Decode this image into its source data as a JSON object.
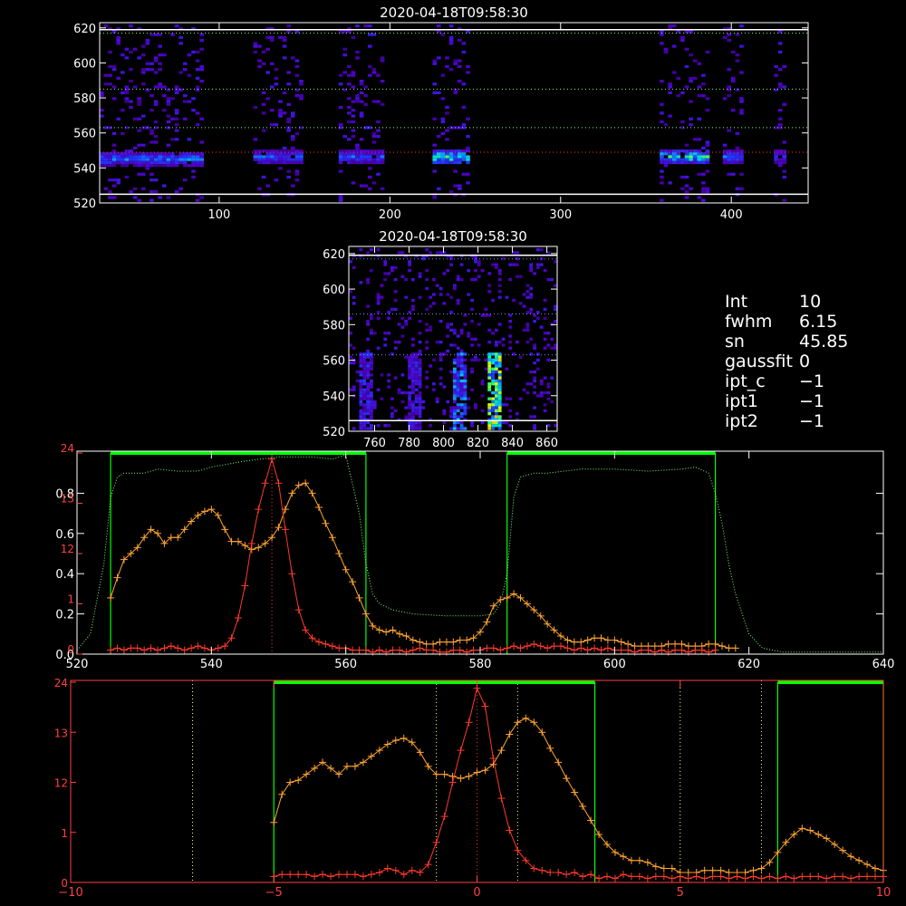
{
  "colors": {
    "background": "#000000",
    "axis_white": "#ffffff",
    "axis_red": "#ff4040",
    "red_profile": "#ff3a2a",
    "orange_profile": "#ffa531",
    "green": "#00ff00",
    "green_dotted": "#7dff7d",
    "yellow_dotted": "#ffff8c",
    "blue_dotted": "#6b8cff",
    "red_dotted": "#ff3030"
  },
  "info_panel": [
    {
      "key": "Int",
      "value": "10"
    },
    {
      "key": "fwhm",
      "value": "6.15"
    },
    {
      "key": "sn",
      "value": "45.85"
    },
    {
      "key": "gaussfit",
      "value": "0"
    },
    {
      "key": "ipt_c",
      "value": "−1"
    },
    {
      "key": "ipt1",
      "value": "−1"
    },
    {
      "key": "ipt2",
      "value": "−1"
    }
  ],
  "chart_data": [
    {
      "type": "heatmap",
      "title": "2020-04-18T09:58:30",
      "xlim": [
        30,
        445
      ],
      "ylim": [
        520,
        623
      ],
      "x_ticks": [
        100,
        200,
        300,
        400
      ],
      "y_ticks": [
        520,
        540,
        560,
        580,
        600,
        620
      ],
      "hlines": [
        {
          "y": 617,
          "color": "#7dff7d",
          "style": "dotted"
        },
        {
          "y": 585,
          "color": "#7dff7d",
          "style": "dotted"
        },
        {
          "y": 563,
          "color": "#7dff7d",
          "style": "dotted"
        },
        {
          "y": 549,
          "color": "#ff3030",
          "style": "dotted"
        },
        {
          "y": 525,
          "color": "#ffffff",
          "style": "solid"
        },
        {
          "y": 619,
          "color": "#ffffff",
          "style": "solid"
        }
      ],
      "bands": [
        {
          "x0": 30,
          "x1": 90,
          "center": 546,
          "peak": 0.6
        },
        {
          "x0": 120,
          "x1": 147,
          "center": 547,
          "peak": 0.55
        },
        {
          "x0": 170,
          "x1": 195,
          "center": 547,
          "peak": 0.55
        },
        {
          "x0": 225,
          "x1": 245,
          "center": 547,
          "peak": 0.85
        },
        {
          "x0": 358,
          "x1": 385,
          "center": 547,
          "peak": 0.8
        },
        {
          "x0": 395,
          "x1": 405,
          "center": 547,
          "peak": 0.6
        },
        {
          "x0": 425,
          "x1": 430,
          "center": 547,
          "peak": 0.5
        }
      ]
    },
    {
      "type": "heatmap",
      "title": "2020-04-18T09:58:30",
      "xlim": [
        745,
        866
      ],
      "ylim": [
        520,
        624
      ],
      "x_ticks": [
        760,
        780,
        800,
        820,
        840,
        860
      ],
      "y_ticks": [
        520,
        540,
        560,
        580,
        600,
        620
      ],
      "hlines": [
        {
          "y": 617,
          "color": "#6b8cff",
          "style": "dotted"
        },
        {
          "y": 586,
          "color": "#6b8cff",
          "style": "dotted"
        },
        {
          "y": 563,
          "color": "#6b8cff",
          "style": "dotted"
        },
        {
          "y": 526,
          "color": "#ffffff",
          "style": "solid"
        },
        {
          "y": 619,
          "color": "#ffffff",
          "style": "solid"
        }
      ],
      "columns": [
        {
          "x": 754,
          "peak": 0.45
        },
        {
          "x": 783,
          "peak": 0.4
        },
        {
          "x": 808,
          "peak": 0.6
        },
        {
          "x": 829,
          "peak": 0.9
        }
      ]
    },
    {
      "type": "line",
      "xlim": [
        520,
        640
      ],
      "ylim_left": [
        0,
        1
      ],
      "ylim_red": [
        0,
        24
      ],
      "x_ticks": [
        520,
        540,
        560,
        580,
        600,
        620,
        640
      ],
      "y_ticks_left": [
        "0.0",
        "0.2",
        "0.4",
        "0.6",
        "0.8"
      ],
      "y_ticks_left_values": [
        0,
        0.2,
        0.4,
        0.6,
        0.8
      ],
      "y_ticks_red": [
        "0",
        "1",
        "12",
        "13",
        "24"
      ],
      "y_ticks_red_values": [
        0,
        6,
        12,
        18,
        24
      ],
      "green_boxes": [
        [
          525,
          563
        ],
        [
          584,
          615
        ]
      ],
      "red_center_line": 549,
      "series": [
        {
          "key": "transmission",
          "style": "dotted",
          "color": "#7dff7d",
          "x": [
            520,
            522,
            524,
            525,
            526,
            527,
            528,
            530,
            532,
            535,
            538,
            540,
            545,
            550,
            555,
            558,
            560,
            562,
            563,
            564,
            565,
            567,
            570,
            575,
            580,
            582,
            583,
            584,
            585,
            586,
            588,
            590,
            595,
            600,
            605,
            610,
            612,
            614,
            615,
            616,
            617,
            618,
            620,
            622,
            625,
            630,
            635,
            640
          ],
          "y": [
            0.02,
            0.1,
            0.45,
            0.78,
            0.88,
            0.9,
            0.9,
            0.9,
            0.92,
            0.91,
            0.91,
            0.93,
            0.96,
            0.98,
            0.98,
            0.97,
            0.99,
            0.7,
            0.45,
            0.3,
            0.25,
            0.22,
            0.2,
            0.19,
            0.19,
            0.2,
            0.25,
            0.4,
            0.78,
            0.88,
            0.9,
            0.9,
            0.92,
            0.92,
            0.91,
            0.92,
            0.93,
            0.9,
            0.8,
            0.65,
            0.45,
            0.3,
            0.1,
            0.03,
            0.01,
            0.01,
            0.01,
            0.01
          ]
        },
        {
          "key": "orange",
          "style": "plus",
          "color": "#ffa531",
          "x": [
            525,
            526,
            527,
            528,
            529,
            530,
            531,
            532,
            533,
            534,
            535,
            536,
            537,
            538,
            539,
            540,
            541,
            542,
            543,
            544,
            545,
            546,
            547,
            548,
            549,
            550,
            551,
            552,
            553,
            554,
            555,
            556,
            557,
            558,
            559,
            560,
            561,
            562,
            563,
            564,
            565,
            566,
            567,
            568,
            569,
            570,
            571,
            572,
            573,
            574,
            575,
            576,
            577,
            578,
            579,
            580,
            581,
            582,
            583,
            584,
            585,
            586,
            587,
            588,
            589,
            590,
            591,
            592,
            593,
            594,
            595,
            596,
            597,
            598,
            599,
            600,
            601,
            602,
            603,
            604,
            605,
            606,
            607,
            608,
            609,
            610,
            611,
            612,
            613,
            614,
            615,
            616,
            617,
            618
          ],
          "y": [
            0.28,
            0.38,
            0.47,
            0.5,
            0.53,
            0.58,
            0.62,
            0.6,
            0.55,
            0.58,
            0.58,
            0.62,
            0.66,
            0.69,
            0.71,
            0.72,
            0.69,
            0.62,
            0.56,
            0.56,
            0.54,
            0.52,
            0.53,
            0.55,
            0.58,
            0.63,
            0.72,
            0.8,
            0.84,
            0.85,
            0.8,
            0.73,
            0.65,
            0.58,
            0.5,
            0.42,
            0.36,
            0.28,
            0.2,
            0.14,
            0.12,
            0.11,
            0.12,
            0.1,
            0.09,
            0.07,
            0.06,
            0.05,
            0.05,
            0.06,
            0.06,
            0.06,
            0.07,
            0.07,
            0.08,
            0.11,
            0.16,
            0.24,
            0.27,
            0.28,
            0.3,
            0.28,
            0.25,
            0.22,
            0.19,
            0.15,
            0.12,
            0.09,
            0.07,
            0.06,
            0.06,
            0.07,
            0.08,
            0.08,
            0.07,
            0.07,
            0.06,
            0.05,
            0.04,
            0.04,
            0.04,
            0.04,
            0.04,
            0.05,
            0.05,
            0.05,
            0.04,
            0.04,
            0.04,
            0.05,
            0.05,
            0.04,
            0.03,
            0.03
          ]
        },
        {
          "key": "red",
          "style": "plus",
          "color": "#ff3a2a",
          "x": [
            525,
            526,
            527,
            528,
            529,
            530,
            531,
            532,
            533,
            534,
            535,
            536,
            537,
            538,
            539,
            540,
            541,
            542,
            543,
            544,
            545,
            546,
            547,
            548,
            549,
            550,
            551,
            552,
            553,
            554,
            555,
            556,
            557,
            558,
            559,
            560,
            561,
            562,
            563,
            564,
            565,
            566,
            567,
            568,
            569,
            570,
            571,
            572,
            573,
            574,
            575,
            576,
            577,
            578,
            579,
            580,
            581,
            582,
            583,
            584,
            585,
            586,
            587,
            588,
            589,
            590,
            591,
            592,
            593,
            594,
            595,
            596,
            597,
            598,
            599,
            600,
            601,
            602,
            603,
            604,
            605,
            606,
            607,
            608,
            609,
            610,
            611,
            612,
            613,
            614,
            615
          ],
          "y": [
            0.02,
            0.03,
            0.02,
            0.03,
            0.03,
            0.02,
            0.03,
            0.02,
            0.03,
            0.04,
            0.03,
            0.02,
            0.03,
            0.04,
            0.03,
            0.02,
            0.03,
            0.04,
            0.08,
            0.18,
            0.34,
            0.55,
            0.72,
            0.85,
            0.97,
            0.85,
            0.62,
            0.4,
            0.22,
            0.12,
            0.08,
            0.06,
            0.05,
            0.04,
            0.03,
            0.03,
            0.02,
            0.02,
            0.02,
            0.01,
            0.02,
            0.01,
            0.02,
            0.02,
            0.01,
            0.02,
            0.03,
            0.02,
            0.02,
            0.01,
            0.01,
            0.02,
            0.02,
            0.01,
            0.02,
            0.02,
            0.03,
            0.03,
            0.02,
            0.03,
            0.04,
            0.03,
            0.04,
            0.05,
            0.04,
            0.03,
            0.04,
            0.04,
            0.03,
            0.02,
            0.03,
            0.02,
            0.03,
            0.02,
            0.03,
            0.02,
            0.02,
            0.02,
            0.01,
            0.02,
            0.02,
            0.01,
            0.02,
            0.01,
            0.02,
            0.02,
            0.01,
            0.02,
            0.02,
            0.01,
            0.02
          ]
        }
      ]
    },
    {
      "type": "line",
      "xlim": [
        -10,
        10
      ],
      "ylim_red": [
        0,
        24
      ],
      "x_ticks": [
        -10,
        -5,
        0,
        5,
        10
      ],
      "y_ticks_red": [
        "0",
        "1",
        "12",
        "13",
        "24"
      ],
      "y_ticks_red_values": [
        0,
        6,
        12,
        18,
        24
      ],
      "green_boxes": [
        [
          -5,
          2.9
        ],
        [
          7.4,
          10
        ]
      ],
      "yellow_vlines": [
        -7,
        -1,
        1,
        5,
        7
      ],
      "red_center_line": 0,
      "series": [
        {
          "key": "orange",
          "style": "plus",
          "color": "#ffa531",
          "x": [
            -5,
            -4.8,
            -4.6,
            -4.4,
            -4.2,
            -4,
            -3.8,
            -3.6,
            -3.4,
            -3.2,
            -3,
            -2.8,
            -2.6,
            -2.4,
            -2.2,
            -2,
            -1.8,
            -1.6,
            -1.4,
            -1.2,
            -1,
            -0.8,
            -0.6,
            -0.4,
            -0.2,
            0,
            0.2,
            0.4,
            0.6,
            0.8,
            1,
            1.2,
            1.4,
            1.6,
            1.8,
            2,
            2.2,
            2.4,
            2.6,
            2.8,
            3,
            3.2,
            3.4,
            3.6,
            3.8,
            4,
            4.2,
            4.4,
            4.6,
            4.8,
            5,
            5.2,
            5.4,
            5.6,
            5.8,
            6,
            6.2,
            6.4,
            6.6,
            6.8,
            7,
            7.2,
            7.4,
            7.6,
            7.8,
            8,
            8.2,
            8.4,
            8.6,
            8.8,
            9,
            9.2,
            9.4,
            9.6,
            9.8,
            10
          ],
          "y": [
            0.3,
            0.44,
            0.5,
            0.51,
            0.54,
            0.57,
            0.6,
            0.57,
            0.54,
            0.58,
            0.58,
            0.6,
            0.63,
            0.66,
            0.69,
            0.71,
            0.72,
            0.7,
            0.65,
            0.58,
            0.54,
            0.54,
            0.53,
            0.52,
            0.53,
            0.55,
            0.56,
            0.59,
            0.66,
            0.74,
            0.8,
            0.82,
            0.8,
            0.75,
            0.67,
            0.6,
            0.52,
            0.45,
            0.38,
            0.31,
            0.24,
            0.19,
            0.15,
            0.13,
            0.11,
            0.11,
            0.1,
            0.08,
            0.07,
            0.07,
            0.05,
            0.05,
            0.05,
            0.06,
            0.06,
            0.06,
            0.05,
            0.05,
            0.05,
            0.06,
            0.07,
            0.1,
            0.15,
            0.2,
            0.24,
            0.27,
            0.26,
            0.24,
            0.22,
            0.19,
            0.16,
            0.13,
            0.11,
            0.09,
            0.07,
            0.06
          ]
        },
        {
          "key": "red",
          "style": "plus",
          "color": "#ff3a2a",
          "x": [
            -5,
            -4.8,
            -4.6,
            -4.4,
            -4.2,
            -4,
            -3.8,
            -3.6,
            -3.4,
            -3.2,
            -3,
            -2.8,
            -2.6,
            -2.4,
            -2.2,
            -2,
            -1.8,
            -1.6,
            -1.4,
            -1.2,
            -1,
            -0.8,
            -0.6,
            -0.4,
            -0.2,
            0,
            0.2,
            0.4,
            0.6,
            0.8,
            1,
            1.2,
            1.4,
            1.6,
            1.8,
            2,
            2.2,
            2.4,
            2.6,
            2.8,
            3,
            3.2,
            3.4,
            3.6,
            3.8,
            4,
            4.2,
            4.4,
            4.6,
            4.8,
            5,
            5.2,
            5.4,
            5.6,
            5.8,
            6,
            6.2,
            6.4,
            6.6,
            6.8,
            7,
            7.2,
            7.4,
            7.6,
            7.8,
            8,
            8.2,
            8.4,
            8.6,
            8.8,
            9,
            9.2,
            9.4,
            9.6,
            9.8,
            10
          ],
          "y": [
            0.03,
            0.04,
            0.04,
            0.04,
            0.04,
            0.03,
            0.04,
            0.03,
            0.04,
            0.04,
            0.04,
            0.03,
            0.04,
            0.05,
            0.07,
            0.06,
            0.04,
            0.06,
            0.05,
            0.09,
            0.2,
            0.33,
            0.5,
            0.66,
            0.8,
            0.97,
            0.88,
            0.62,
            0.42,
            0.26,
            0.16,
            0.11,
            0.07,
            0.06,
            0.05,
            0.05,
            0.04,
            0.05,
            0.03,
            0.04,
            0.02,
            0.03,
            0.02,
            0.04,
            0.03,
            0.03,
            0.02,
            0.03,
            0.03,
            0.02,
            0.03,
            0.02,
            0.03,
            0.02,
            0.03,
            0.03,
            0.02,
            0.03,
            0.02,
            0.03,
            0.02,
            0.03,
            0.02,
            0.03,
            0.02,
            0.03,
            0.03,
            0.03,
            0.02,
            0.03,
            0.03,
            0.02,
            0.03,
            0.03,
            0.03,
            0.03
          ]
        }
      ]
    }
  ]
}
